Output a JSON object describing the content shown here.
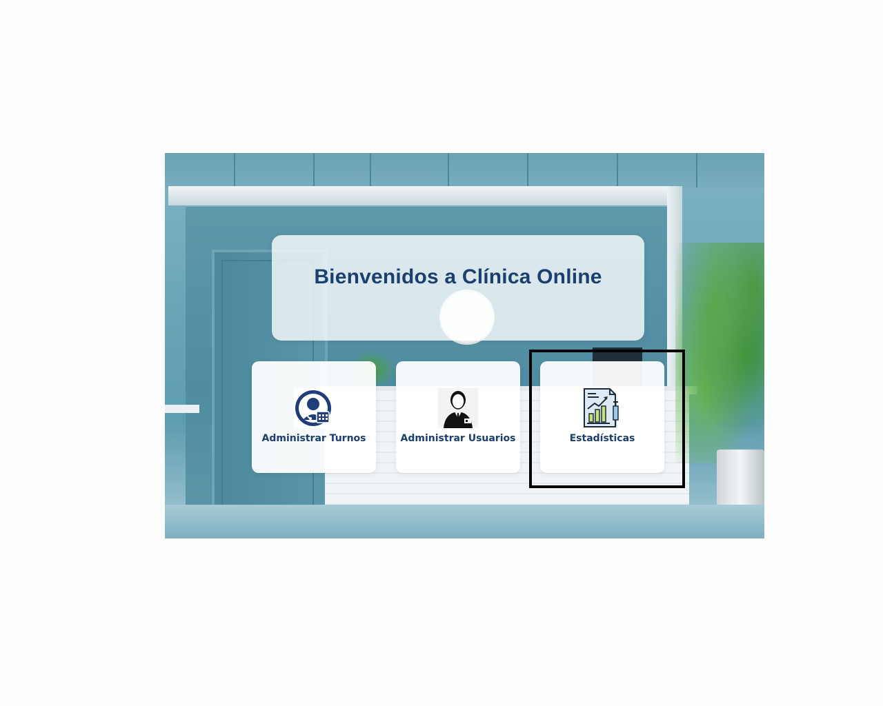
{
  "welcome": {
    "title": "Bienvenidos a Clínica Online"
  },
  "options": [
    {
      "label": "Administrar Turnos",
      "icon": "doctor-calendar-icon"
    },
    {
      "label": "Administrar Usuarios",
      "icon": "user-badge-icon"
    },
    {
      "label": "Estadísticas",
      "icon": "stats-report-icon"
    }
  ],
  "colors": {
    "title": "#1b3f6f",
    "label": "#1b3f6f",
    "focus_border": "#000000"
  }
}
